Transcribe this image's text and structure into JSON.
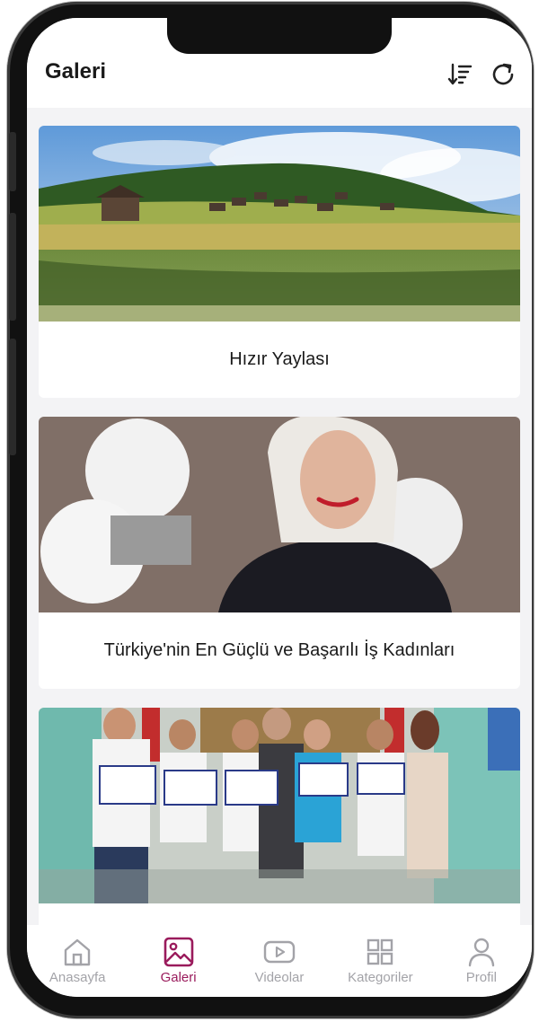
{
  "header": {
    "title": "Galeri",
    "sort_icon": "sort-descending-icon",
    "refresh_icon": "refresh-icon"
  },
  "gallery": {
    "items": [
      {
        "caption": "Hızır Yaylası",
        "image": "landscape-lake-photo"
      },
      {
        "caption": "Türkiye'nin En Güçlü ve Başarılı İş Kadınları",
        "image": "portrait-woman-photo"
      },
      {
        "caption": "",
        "image": "students-certificates-photo"
      }
    ]
  },
  "bottom_nav": {
    "items": [
      {
        "label": "Anasayfa",
        "icon": "home-icon",
        "active": false
      },
      {
        "label": "Galeri",
        "icon": "image-icon",
        "active": true
      },
      {
        "label": "Videolar",
        "icon": "video-icon",
        "active": false
      },
      {
        "label": "Kategoriler",
        "icon": "grid-icon",
        "active": false
      },
      {
        "label": "Profil",
        "icon": "user-icon",
        "active": false
      }
    ]
  },
  "colors": {
    "accent": "#9a1b5c",
    "inactive": "#a3a3a8",
    "background": "#f3f3f5"
  }
}
